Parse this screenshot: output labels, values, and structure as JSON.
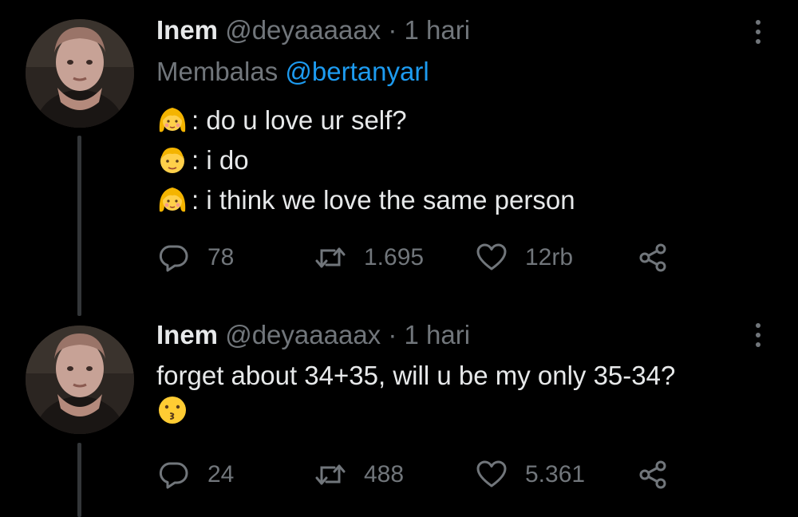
{
  "tweets": [
    {
      "name": "Inem",
      "handle": "@deyaaaaax",
      "separator": "·",
      "time": "1 hari",
      "reply_prefix": "Membalas",
      "reply_mention": "@bertanyarl",
      "lines": [
        {
          "emoji": "woman-face",
          "text": ": do u love ur self?"
        },
        {
          "emoji": "man-face",
          "text": ": i do"
        },
        {
          "emoji": "woman-face",
          "text": ": i think we love the same person"
        }
      ],
      "stats": {
        "replies": "78",
        "retweets": "1.695",
        "likes": "12rb"
      }
    },
    {
      "name": "Inem",
      "handle": "@deyaaaaax",
      "separator": "·",
      "time": "1 hari",
      "text": "forget about 34+35, will u be my only 35-34?",
      "emoji": "kissing-face",
      "stats": {
        "replies": "24",
        "retweets": "488",
        "likes": "5.361"
      }
    }
  ],
  "icons": {
    "reply": "reply-icon",
    "retweet": "retweet-icon",
    "like": "heart-icon",
    "share": "share-icon",
    "more": "more-vertical-icon"
  },
  "colors": {
    "background": "#000000",
    "text": "#e7e9ea",
    "muted": "#71767b",
    "link": "#1d9bf0",
    "thread_line": "#333639"
  }
}
